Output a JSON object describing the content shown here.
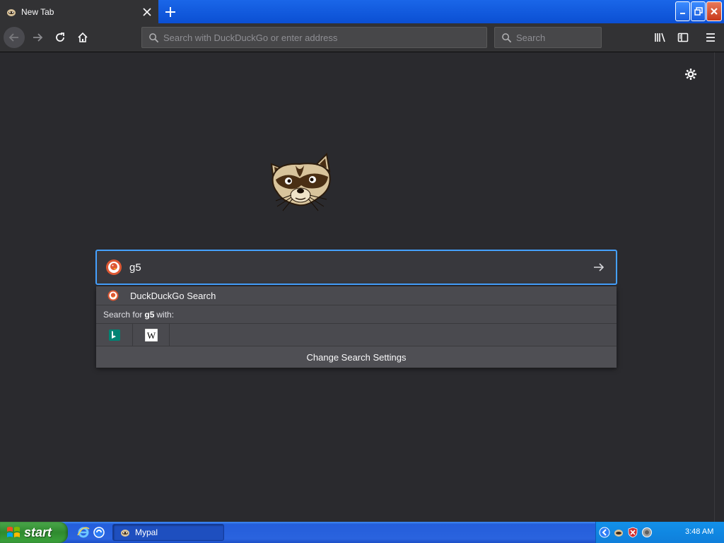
{
  "window": {
    "tab_title": "New Tab",
    "close_tab_label": "×",
    "new_tab_label": "+"
  },
  "navbar": {
    "urlbar_placeholder": "Search with DuckDuckGo or enter address",
    "searchbar_placeholder": "Search"
  },
  "newtab": {
    "search_value": "g5",
    "dropdown": {
      "engine_label": "DuckDuckGo Search",
      "search_for_prefix": "Search for",
      "search_for_term": "g5",
      "search_for_suffix": "with:",
      "one_off_engines": [
        "Bing",
        "Wikipedia"
      ],
      "settings_label": "Change Search Settings"
    }
  },
  "taskbar": {
    "start_label": "start",
    "task_label": "Mypal",
    "clock": "3:48 AM"
  },
  "colors": {
    "focus_ring": "#45a1ff",
    "content_bg": "#2a2a2e",
    "toolbar_bg": "#323234",
    "taskbar_blue": "#245edb",
    "start_green": "#3ca43c"
  }
}
